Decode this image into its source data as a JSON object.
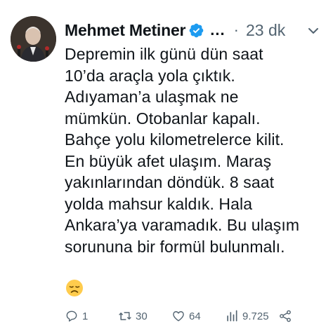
{
  "tweet": {
    "author_name": "Mehmet Metiner",
    "more_label": "...",
    "dot": "·",
    "time": "23 dk",
    "text_lines": [
      "Depremin ilk günü dün saat",
      "10’da araçla yola çıktık.",
      "Adıyaman’a ulaşmak ne",
      "mümkün. Otobanlar kapalı.",
      "Bahçe yolu kilometrelerce kilit.",
      "En büyük afet ulaşım. Maraş",
      "yakınlarından döndük. 8 saat",
      "yolda mahsur kaldık. Hala",
      "Ankara’ya varamadık. Bu ulaşım",
      "sorununa bir formül bulunmalı."
    ],
    "emoji": "disappointed-face-emoji"
  },
  "actions": {
    "reply_count": "1",
    "retweet_count": "30",
    "like_count": "64",
    "views_count": "9.725"
  },
  "colors": {
    "verified": "#1d9bf0",
    "muted": "#536471",
    "text": "#0f1419"
  },
  "icons": [
    "verified-badge-icon",
    "more-icon",
    "reply-icon",
    "retweet-icon",
    "like-icon",
    "views-icon",
    "share-icon"
  ]
}
